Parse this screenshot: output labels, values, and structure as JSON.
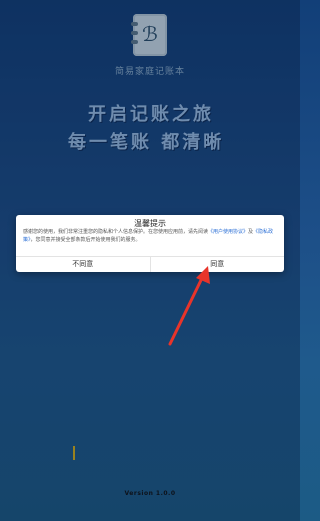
{
  "app": {
    "name": "简易家庭记账本",
    "logo_glyph": "ℬ",
    "logo_icon": "notebook-icon"
  },
  "slogan": {
    "line1": "开启记账之旅",
    "line2": "每一笔账 都清晰"
  },
  "dialog": {
    "title": "温馨提示",
    "body_intro": "感谢您的使用，我们非常注重您的隐私和个人信息保护。在您使用应用前，请先阅读",
    "user_agreement_link": "《用户使用协议》",
    "conjunction": "及",
    "privacy_policy_link": "《隐私政策》",
    "body_outro": "，您同意并接受全部条款后开始使用我们的服务。",
    "disagree_label": "不同意",
    "agree_label": "同意"
  },
  "version_text": "Version 1.0.0",
  "colors": {
    "background_top": "#123f78",
    "background_bottom": "#1c5b85",
    "link": "#2b6fd6",
    "arrow": "#e8342a"
  }
}
